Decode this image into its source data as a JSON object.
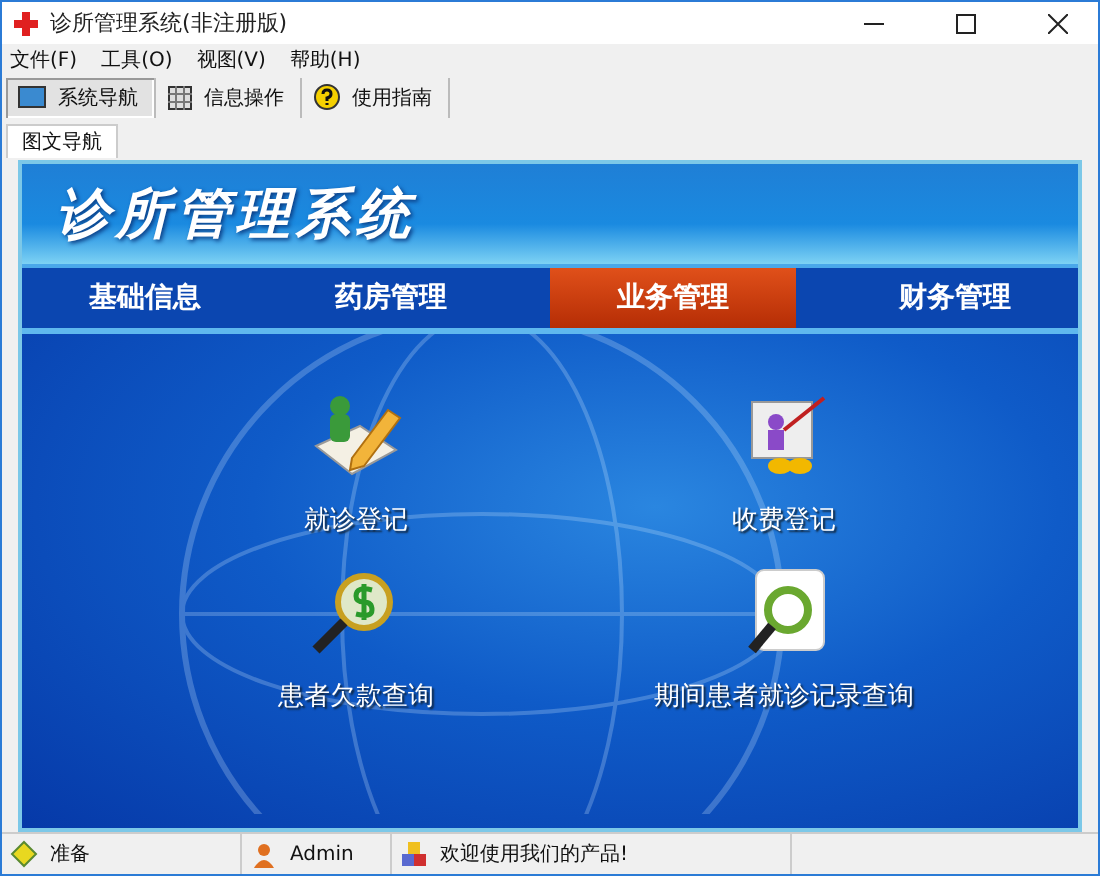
{
  "window": {
    "title": "诊所管理系统(非注册版)"
  },
  "menu": [
    "文件(F)",
    "工具(O)",
    "视图(V)",
    "帮助(H)"
  ],
  "toolbar": [
    {
      "label": "系统导航",
      "kind": "monitor",
      "selected": true
    },
    {
      "label": "信息操作",
      "kind": "grid",
      "selected": false
    },
    {
      "label": "使用指南",
      "kind": "help",
      "selected": false
    }
  ],
  "tabs": [
    {
      "label": "图文导航",
      "selected": true
    }
  ],
  "banner": {
    "title": "诊所管理系统"
  },
  "nav": [
    {
      "label": "基础信息",
      "selected": false
    },
    {
      "label": "药房管理",
      "selected": false
    },
    {
      "label": "业务管理",
      "selected": true
    },
    {
      "label": "财务管理",
      "selected": false
    }
  ],
  "actions": [
    {
      "label": "就诊登记",
      "kind": "register"
    },
    {
      "label": "收费登记",
      "kind": "fee"
    },
    {
      "label": "患者欠款查询",
      "kind": "debt"
    },
    {
      "label": "期间患者就诊记录查询",
      "kind": "record"
    }
  ],
  "status": [
    {
      "text": "准备",
      "kind": "ready"
    },
    {
      "text": "Admin",
      "kind": "user"
    },
    {
      "text": "欢迎使用我们的产品!",
      "kind": "welcome"
    }
  ]
}
